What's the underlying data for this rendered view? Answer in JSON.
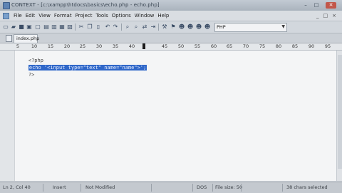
{
  "window": {
    "title": "CONTEXT - [c:\\xampp\\htdocs\\basics\\echo.php - echo.php]",
    "minimize": "–",
    "maximize": "□",
    "close": "✕"
  },
  "menubar": {
    "items": [
      "File",
      "Edit",
      "View",
      "Format",
      "Project",
      "Tools",
      "Options",
      "Window",
      "Help"
    ],
    "right": [
      "_",
      "□",
      "×"
    ]
  },
  "toolbar": {
    "language_value": "PHP"
  },
  "tabs": [
    {
      "label": "index.php"
    }
  ],
  "ruler": {
    "labels": [
      "5",
      "10",
      "15",
      "20",
      "25",
      "30",
      "35",
      "40",
      "45",
      "50",
      "55",
      "60",
      "65",
      "70",
      "75",
      "80",
      "85",
      "90",
      "95"
    ]
  },
  "editor": {
    "lines": [
      {
        "text": "<?php"
      },
      {
        "selected": "echo '<input type=\"text\" name=\"name\">';"
      },
      {
        "text": "?>"
      }
    ]
  },
  "statusbar": {
    "position": "Ln 2, Col 40",
    "mode": "Insert",
    "save_state": "Not Modified",
    "encoding": "DOS",
    "file_size": "File size: 50",
    "selection": "38 chars selected"
  }
}
